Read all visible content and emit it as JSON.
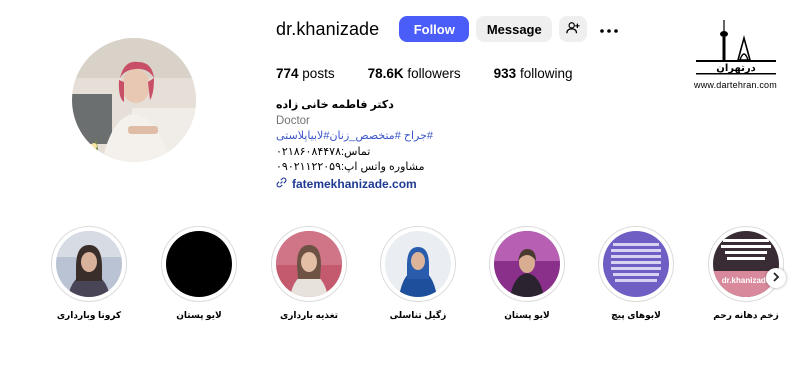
{
  "profile": {
    "username": "dr.khanizade",
    "follow_label": "Follow",
    "message_label": "Message",
    "add_user_icon": "add-user-icon",
    "more_icon": "more-horizontal-icon",
    "avatar_icon": "profile-photo"
  },
  "stats": {
    "posts_count": "774",
    "posts_label": "posts",
    "followers_count": "78.6K",
    "followers_label": "followers",
    "following_count": "933",
    "following_label": "following"
  },
  "bio": {
    "name": "دکتر فاطمه خانی زاده",
    "category": "Doctor",
    "tags": "#جراح #متخصص_زنان#لابیاپلاستی",
    "phone": "تماس:۰۲۱۸۶۰۸۴۴۷۸",
    "whatsapp": "مشاوره واتس اپ:۰۹۰۲۱۱۲۲۰۵۹",
    "link": "fatemekhanizade.com",
    "link_icon": "link-icon"
  },
  "watermark": {
    "brand_text": "درتهران",
    "url": "www.dartehran.com"
  },
  "highlights": [
    {
      "label": "زخم دهانه رحم",
      "thumb_text": "dr.khanizade"
    },
    {
      "label": "لابوهای پیچ"
    },
    {
      "label": "لایو پستان"
    },
    {
      "label": "زگیل تناسلی"
    },
    {
      "label": "تغذیه بارداری"
    },
    {
      "label": "لایو پستان"
    },
    {
      "label": "کرونا وبارداری"
    }
  ],
  "highlights_next_icon": "chevron-right-icon",
  "colors": {
    "follow_button": "#4a5df9",
    "secondary_button": "#efefef",
    "hashtag": "#3b56c8",
    "link": "#1f3a93",
    "muted": "#737373"
  }
}
